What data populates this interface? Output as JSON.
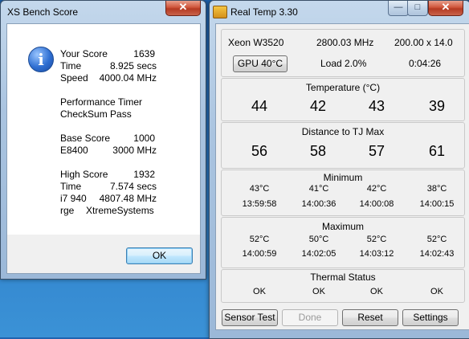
{
  "xs_window": {
    "title": "XS Bench Score",
    "close_label": "✕",
    "score_rows": [
      {
        "label": "Your Score",
        "value": "1639"
      },
      {
        "label": "Time",
        "value": "8.925 secs"
      },
      {
        "label": "Speed",
        "value": "4000.04 MHz"
      }
    ],
    "perf_lines": [
      "Performance Timer",
      "CheckSum Pass"
    ],
    "base_rows": [
      {
        "label": "Base Score",
        "value": "1000"
      },
      {
        "label": "E8400",
        "value": "3000 MHz"
      }
    ],
    "high_rows": [
      {
        "label": "High Score",
        "value": "1932"
      },
      {
        "label": "Time",
        "value": "7.574 secs"
      },
      {
        "label": "i7 940",
        "value": "4807.48 MHz"
      },
      {
        "label": "rge",
        "value": "XtremeSystems"
      }
    ],
    "ok_label": "OK"
  },
  "rt_window": {
    "title": "Real Temp 3.30",
    "minimize_label": "—",
    "maximize_label": "□",
    "close_label": "✕",
    "cpu_name": "Xeon W3520",
    "cpu_speed": "2800.03 MHz",
    "multiplier": "200.00 x 14.0",
    "gpu_button": "GPU  40°C",
    "load": "Load   2.0%",
    "uptime": "0:04:26",
    "temperature": {
      "header": "Temperature  (°C)",
      "values": [
        "44",
        "42",
        "43",
        "39"
      ]
    },
    "distance": {
      "header": "Distance to TJ Max",
      "values": [
        "56",
        "58",
        "57",
        "61"
      ]
    },
    "minimum": {
      "header": "Minimum",
      "temps": [
        "43°C",
        "41°C",
        "42°C",
        "38°C"
      ],
      "times": [
        "13:59:58",
        "14:00:36",
        "14:00:08",
        "14:00:15"
      ]
    },
    "maximum": {
      "header": "Maximum",
      "temps": [
        "52°C",
        "50°C",
        "52°C",
        "52°C"
      ],
      "times": [
        "14:00:59",
        "14:02:05",
        "14:03:12",
        "14:02:43"
      ]
    },
    "thermal": {
      "header": "Thermal Status",
      "values": [
        "OK",
        "OK",
        "OK",
        "OK"
      ]
    },
    "buttons": {
      "sensor_test": "Sensor Test",
      "done": "Done",
      "reset": "Reset",
      "settings": "Settings"
    }
  }
}
